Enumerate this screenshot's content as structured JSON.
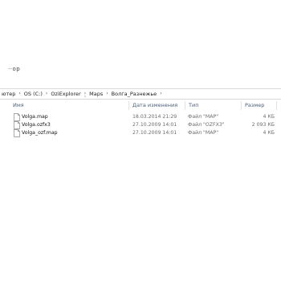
{
  "window": {
    "top_fragment": "··ор"
  },
  "breadcrumb": {
    "items": [
      "ютер",
      "OS (C:)",
      "OziExplorer",
      "Maps",
      "Волга_Разнежье"
    ],
    "separator": "›"
  },
  "columns": {
    "name": "Имя",
    "date": "Дата изменения",
    "type": "Тип",
    "size": "Размер"
  },
  "files": [
    {
      "name": "Volga.map",
      "date": "18.03.2014 21:29",
      "type": "Файл \"MAP\"",
      "size": "4 КБ",
      "icon": "file-icon"
    },
    {
      "name": "Volga.ozfx3",
      "date": "27.10.2009 14:01",
      "type": "Файл \"OZFX3\"",
      "size": "2 093 КБ",
      "icon": "file-icon"
    },
    {
      "name": "Volga_ozf.map",
      "date": "27.10.2009 14:01",
      "type": "Файл \"MAP\"",
      "size": "4 КБ",
      "icon": "file-icon"
    }
  ]
}
